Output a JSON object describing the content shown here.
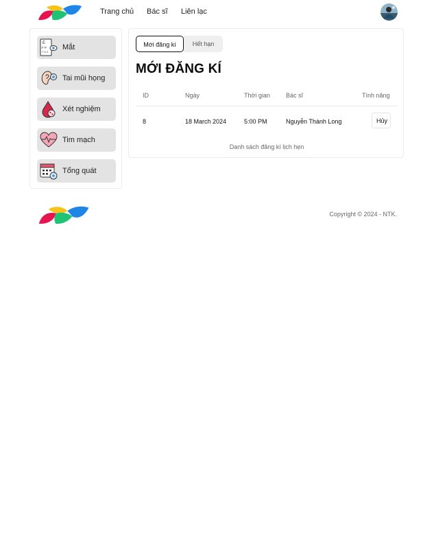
{
  "header": {
    "nav": [
      {
        "label": "Trang chủ"
      },
      {
        "label": "Bác sĩ"
      },
      {
        "label": "Liên lạc"
      }
    ]
  },
  "sidebar": {
    "items": [
      {
        "label": "Mắt",
        "icon": "eye-chart-icon"
      },
      {
        "label": "Tai mũi họng",
        "icon": "ear-icon"
      },
      {
        "label": "Xét nghiệm",
        "icon": "blood-drop-icon"
      },
      {
        "label": "Tim mạch",
        "icon": "heartbeat-icon"
      },
      {
        "label": "Tổng quát",
        "icon": "calendar-icon"
      }
    ]
  },
  "main": {
    "tabs": [
      {
        "label": "Mới đăng kí",
        "active": true
      },
      {
        "label": "Hết hạn",
        "active": false
      }
    ],
    "title": "MỚI ĐĂNG KÍ",
    "table": {
      "columns": [
        "ID",
        "Ngày",
        "Thời gian",
        "Bác sĩ",
        "Tính năng"
      ],
      "rows": [
        {
          "id": "8",
          "date": "18 March 2024",
          "time": "5:00 PM",
          "doctor": "Nguyễn Thành Long",
          "action": "Hủy"
        }
      ]
    },
    "caption": "Danh sách đăng kí lịch hẹn"
  },
  "footer": {
    "copyright": "Copyright © 2024 - NTK."
  },
  "colors": {
    "logo_red": "#e8144f",
    "logo_yellow": "#f7c31a",
    "logo_green": "#20c374",
    "logo_blue": "#1f86e8"
  }
}
